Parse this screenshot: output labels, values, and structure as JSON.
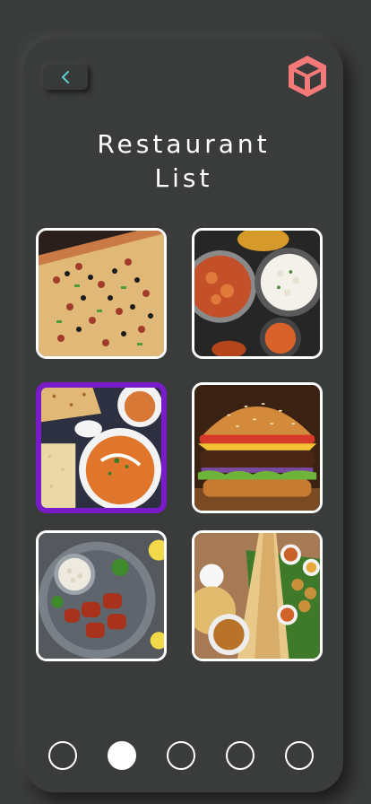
{
  "screen": {
    "title_line1": "Restaurant",
    "title_line2": "List"
  },
  "icons": {
    "back": "chevron-left-icon",
    "logo": "cube-logo-icon"
  },
  "colors": {
    "background": "#3a3c3b",
    "logo": "#f47a7a",
    "back_chevron": "#5fd0d0",
    "selected_border": "#7a1bc9",
    "tile_border": "#ffffff"
  },
  "restaurants": [
    {
      "name": "pizza",
      "selected": false
    },
    {
      "name": "curry-thali",
      "selected": false
    },
    {
      "name": "paneer-naan",
      "selected": true
    },
    {
      "name": "burger",
      "selected": false
    },
    {
      "name": "tandoori-chicken",
      "selected": false
    },
    {
      "name": "dosa-platter",
      "selected": false
    }
  ],
  "pagination": {
    "pages": 5,
    "active_page": 2
  }
}
